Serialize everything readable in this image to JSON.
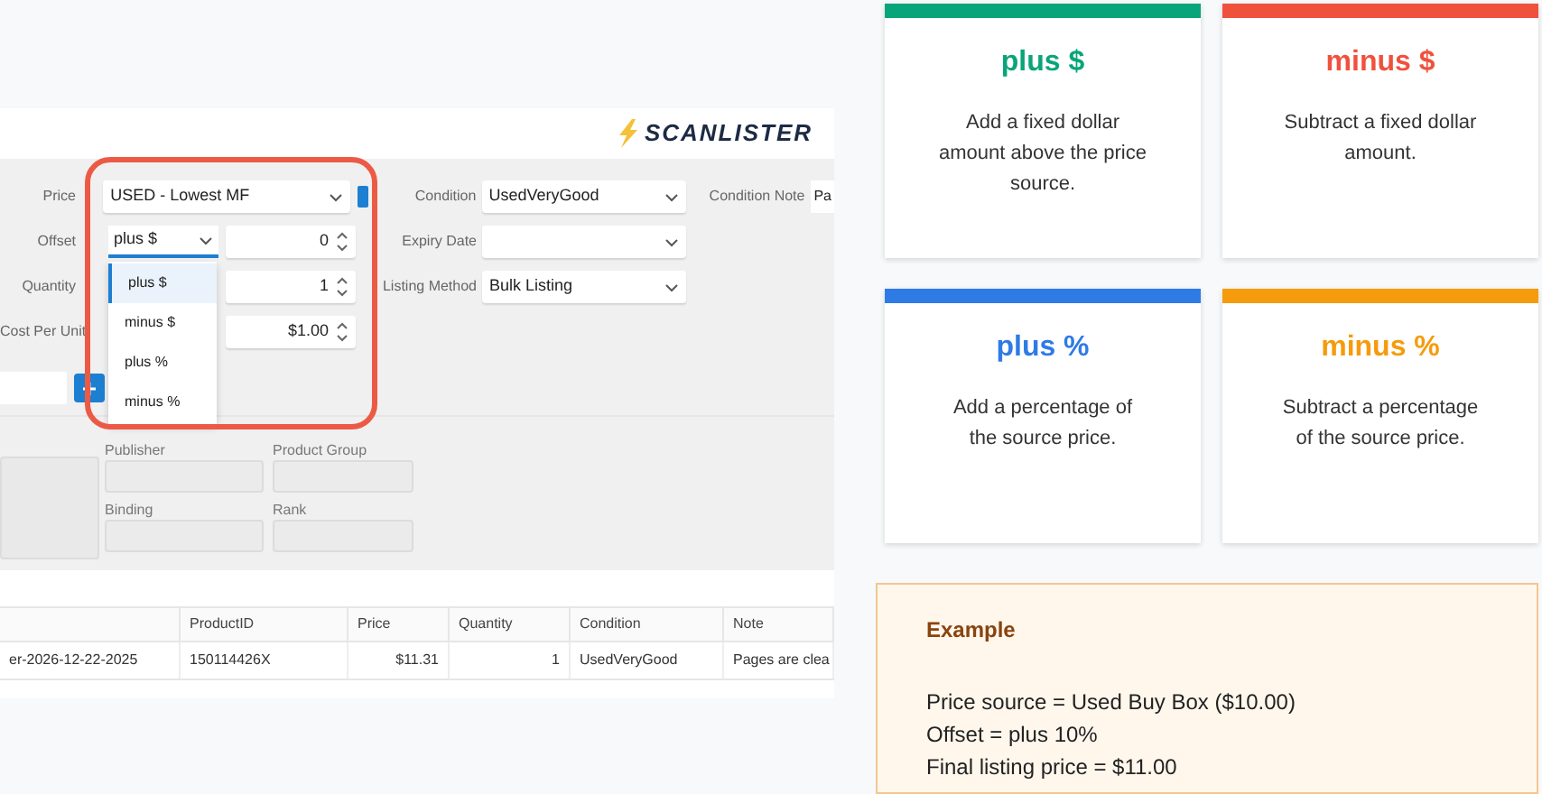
{
  "app": {
    "logo": "SCANLISTER",
    "form": {
      "price": {
        "label": "Price",
        "value": "USED - Lowest MF",
        "checked": true
      },
      "offset": {
        "label": "Offset",
        "value": "plus $",
        "amount": "0",
        "open": true,
        "options": [
          {
            "label": "plus $",
            "selected": true
          },
          {
            "label": "minus $",
            "selected": false
          },
          {
            "label": "plus %",
            "selected": false
          },
          {
            "label": "minus %",
            "selected": false
          }
        ]
      },
      "quantity": {
        "label": "Quantity",
        "value": "1"
      },
      "cost_per_unit": {
        "label": "Cost Per Unit",
        "value": "$1.00"
      },
      "condition": {
        "label": "Condition",
        "value": "UsedVeryGood"
      },
      "condition_note": {
        "label": "Condition Note",
        "value": "Pa"
      },
      "expiry_date": {
        "label": "Expiry Date"
      },
      "listing_method": {
        "label": "Listing Method",
        "value": "Bulk Listing"
      }
    },
    "details": [
      {
        "label": "Publisher"
      },
      {
        "label": "Product Group"
      },
      {
        "label": "Binding"
      },
      {
        "label": "Rank"
      }
    ],
    "table": {
      "columns": [
        "",
        "ProductID",
        "Price",
        "Quantity",
        "Condition",
        "Note"
      ],
      "rows": [
        [
          "er-2026-12-22-2025",
          "150114426X",
          "$11.31",
          "1",
          "UsedVeryGood",
          "Pages are clea"
        ]
      ]
    }
  },
  "cards": [
    {
      "title": "plus $",
      "text": "Add a fixed dollar amount above the price source.",
      "color": "#08a57a"
    },
    {
      "title": "minus $",
      "text": "Subtract a fixed dollar amount.",
      "color": "#f0513d"
    },
    {
      "title": "plus %",
      "text": "Add a percentage of the source price.",
      "color": "#2f7be6"
    },
    {
      "title": "minus %",
      "text": "Subtract a percentage of the source price.",
      "color": "#f59b0c"
    }
  ],
  "example": {
    "title": "Example",
    "lines": [
      "Price source = Used Buy Box ($10.00)",
      "Offset = plus 10%",
      "Final listing price = $11.00"
    ]
  }
}
